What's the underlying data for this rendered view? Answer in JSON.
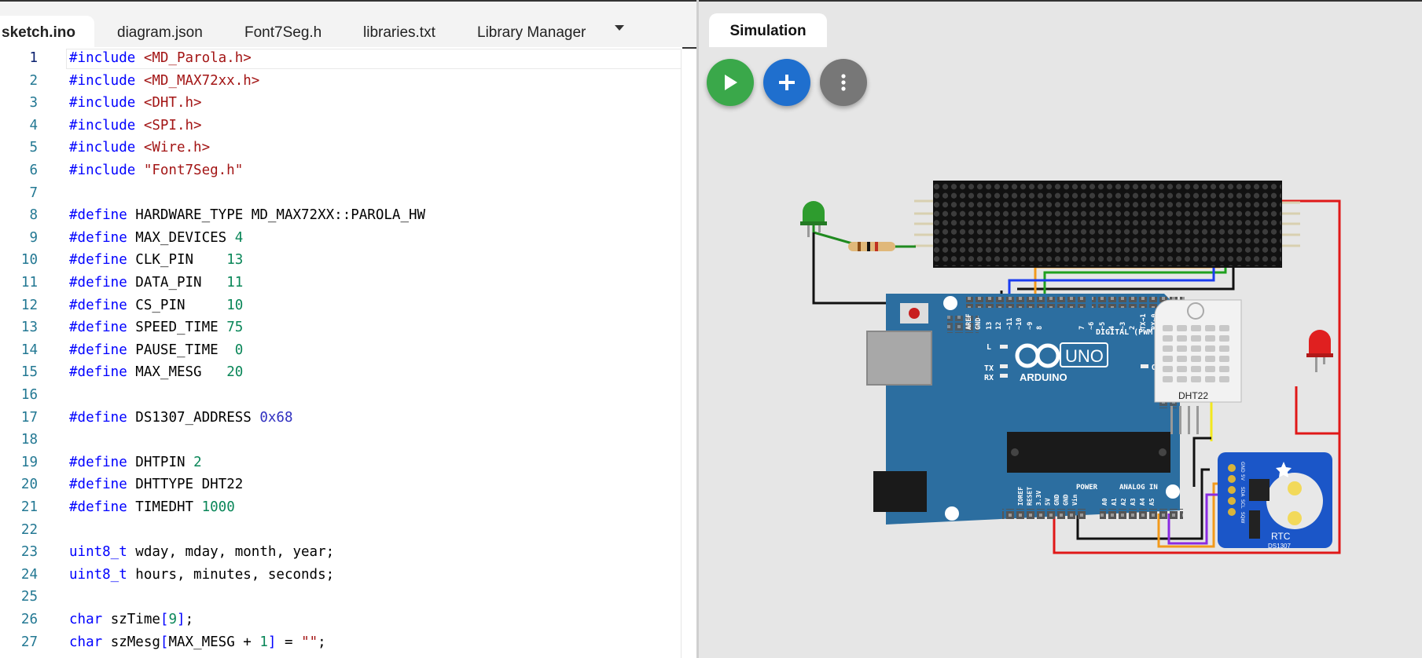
{
  "tabs": [
    {
      "label": "sketch.ino",
      "active": true
    },
    {
      "label": "diagram.json"
    },
    {
      "label": "Font7Seg.h"
    },
    {
      "label": "libraries.txt"
    },
    {
      "label": "Library Manager"
    }
  ],
  "sim_tab": "Simulation",
  "buttons": {
    "play": "play-icon",
    "add": "plus-icon",
    "more": "more-vert-icon"
  },
  "code_lines": [
    {
      "n": "1",
      "tokens": [
        [
          "kw",
          "#include "
        ],
        [
          "str",
          "<MD_Parola.h>"
        ]
      ]
    },
    {
      "n": "2",
      "tokens": [
        [
          "kw",
          "#include "
        ],
        [
          "str",
          "<MD_MAX72xx.h>"
        ]
      ]
    },
    {
      "n": "3",
      "tokens": [
        [
          "kw",
          "#include "
        ],
        [
          "str",
          "<DHT.h>"
        ]
      ]
    },
    {
      "n": "4",
      "tokens": [
        [
          "kw",
          "#include "
        ],
        [
          "str",
          "<SPI.h>"
        ]
      ]
    },
    {
      "n": "5",
      "tokens": [
        [
          "kw",
          "#include "
        ],
        [
          "str",
          "<Wire.h>"
        ]
      ]
    },
    {
      "n": "6",
      "tokens": [
        [
          "kw",
          "#include "
        ],
        [
          "str",
          "\"Font7Seg.h\""
        ]
      ]
    },
    {
      "n": "7",
      "tokens": []
    },
    {
      "n": "8",
      "tokens": [
        [
          "kw",
          "#define "
        ],
        [
          "",
          "HARDWARE_TYPE MD_MAX72XX::PAROLA_HW"
        ]
      ]
    },
    {
      "n": "9",
      "tokens": [
        [
          "kw",
          "#define "
        ],
        [
          "",
          "MAX_DEVICES "
        ],
        [
          "num",
          "4"
        ]
      ]
    },
    {
      "n": "10",
      "tokens": [
        [
          "kw",
          "#define "
        ],
        [
          "",
          "CLK_PIN    "
        ],
        [
          "num",
          "13"
        ]
      ]
    },
    {
      "n": "11",
      "tokens": [
        [
          "kw",
          "#define "
        ],
        [
          "",
          "DATA_PIN   "
        ],
        [
          "num",
          "11"
        ]
      ]
    },
    {
      "n": "12",
      "tokens": [
        [
          "kw",
          "#define "
        ],
        [
          "",
          "CS_PIN     "
        ],
        [
          "num",
          "10"
        ]
      ]
    },
    {
      "n": "13",
      "tokens": [
        [
          "kw",
          "#define "
        ],
        [
          "",
          "SPEED_TIME "
        ],
        [
          "num",
          "75"
        ]
      ]
    },
    {
      "n": "14",
      "tokens": [
        [
          "kw",
          "#define "
        ],
        [
          "",
          "PAUSE_TIME  "
        ],
        [
          "num",
          "0"
        ]
      ]
    },
    {
      "n": "15",
      "tokens": [
        [
          "kw",
          "#define "
        ],
        [
          "",
          "MAX_MESG   "
        ],
        [
          "num",
          "20"
        ]
      ]
    },
    {
      "n": "16",
      "tokens": []
    },
    {
      "n": "17",
      "tokens": [
        [
          "kw",
          "#define "
        ],
        [
          "",
          "DS1307_ADDRESS "
        ],
        [
          "hex",
          "0x68"
        ]
      ]
    },
    {
      "n": "18",
      "tokens": []
    },
    {
      "n": "19",
      "tokens": [
        [
          "kw",
          "#define "
        ],
        [
          "",
          "DHTPIN "
        ],
        [
          "num",
          "2"
        ]
      ]
    },
    {
      "n": "20",
      "tokens": [
        [
          "kw",
          "#define "
        ],
        [
          "",
          "DHTTYPE DHT22"
        ]
      ]
    },
    {
      "n": "21",
      "tokens": [
        [
          "kw",
          "#define "
        ],
        [
          "",
          "TIMEDHT "
        ],
        [
          "num",
          "1000"
        ]
      ]
    },
    {
      "n": "22",
      "tokens": []
    },
    {
      "n": "23",
      "tokens": [
        [
          "kw",
          "uint8_t"
        ],
        [
          "",
          " wday, mday, month, year;"
        ]
      ]
    },
    {
      "n": "24",
      "tokens": [
        [
          "kw",
          "uint8_t"
        ],
        [
          "",
          " hours, minutes, seconds;"
        ]
      ]
    },
    {
      "n": "25",
      "tokens": []
    },
    {
      "n": "26",
      "tokens": [
        [
          "kw",
          "char"
        ],
        [
          "",
          " szTime"
        ],
        [
          "kw",
          "["
        ],
        [
          "num",
          "9"
        ],
        [
          "kw",
          "]"
        ],
        [
          "",
          ";"
        ]
      ]
    },
    {
      "n": "27",
      "tokens": [
        [
          "kw",
          "char"
        ],
        [
          "",
          " szMesg"
        ],
        [
          "kw",
          "["
        ],
        [
          "",
          "MAX_MESG + "
        ],
        [
          "num",
          "1"
        ],
        [
          "kw",
          "]"
        ],
        [
          "",
          " = "
        ],
        [
          "str",
          "\"\""
        ],
        [
          "",
          ";"
        ]
      ]
    }
  ],
  "board": {
    "brand": "ARDUINO",
    "model": "UNO",
    "digital_label": "DIGITAL (PWM ~)",
    "power_label": "POWER",
    "analog_label": "ANALOG IN",
    "pin_labels_top": [
      "AREF",
      "GND",
      "13",
      "12",
      "~11",
      "~10",
      "~9",
      "8",
      "7",
      "~6",
      "~5",
      "4",
      "~3",
      "2",
      "TX→1",
      "RX←0"
    ],
    "pin_labels_power": [
      "IOREF",
      "RESET",
      "3.3V",
      "5V",
      "GND",
      "GND",
      "Vin"
    ],
    "pin_labels_analog": [
      "A0",
      "A1",
      "A2",
      "A3",
      "A4",
      "A5"
    ],
    "led_labels": [
      "L",
      "TX",
      "RX",
      "ON"
    ]
  },
  "dht_label": "DHT22",
  "rtc": {
    "label": "RTC",
    "chip": "DS1307",
    "pins": [
      "GND",
      "5V",
      "SDA",
      "SCL",
      "SQW"
    ]
  },
  "colors": {
    "play": "#3aa84a",
    "add": "#1f6fce",
    "more": "#777777",
    "board": "#2c6ea0"
  }
}
